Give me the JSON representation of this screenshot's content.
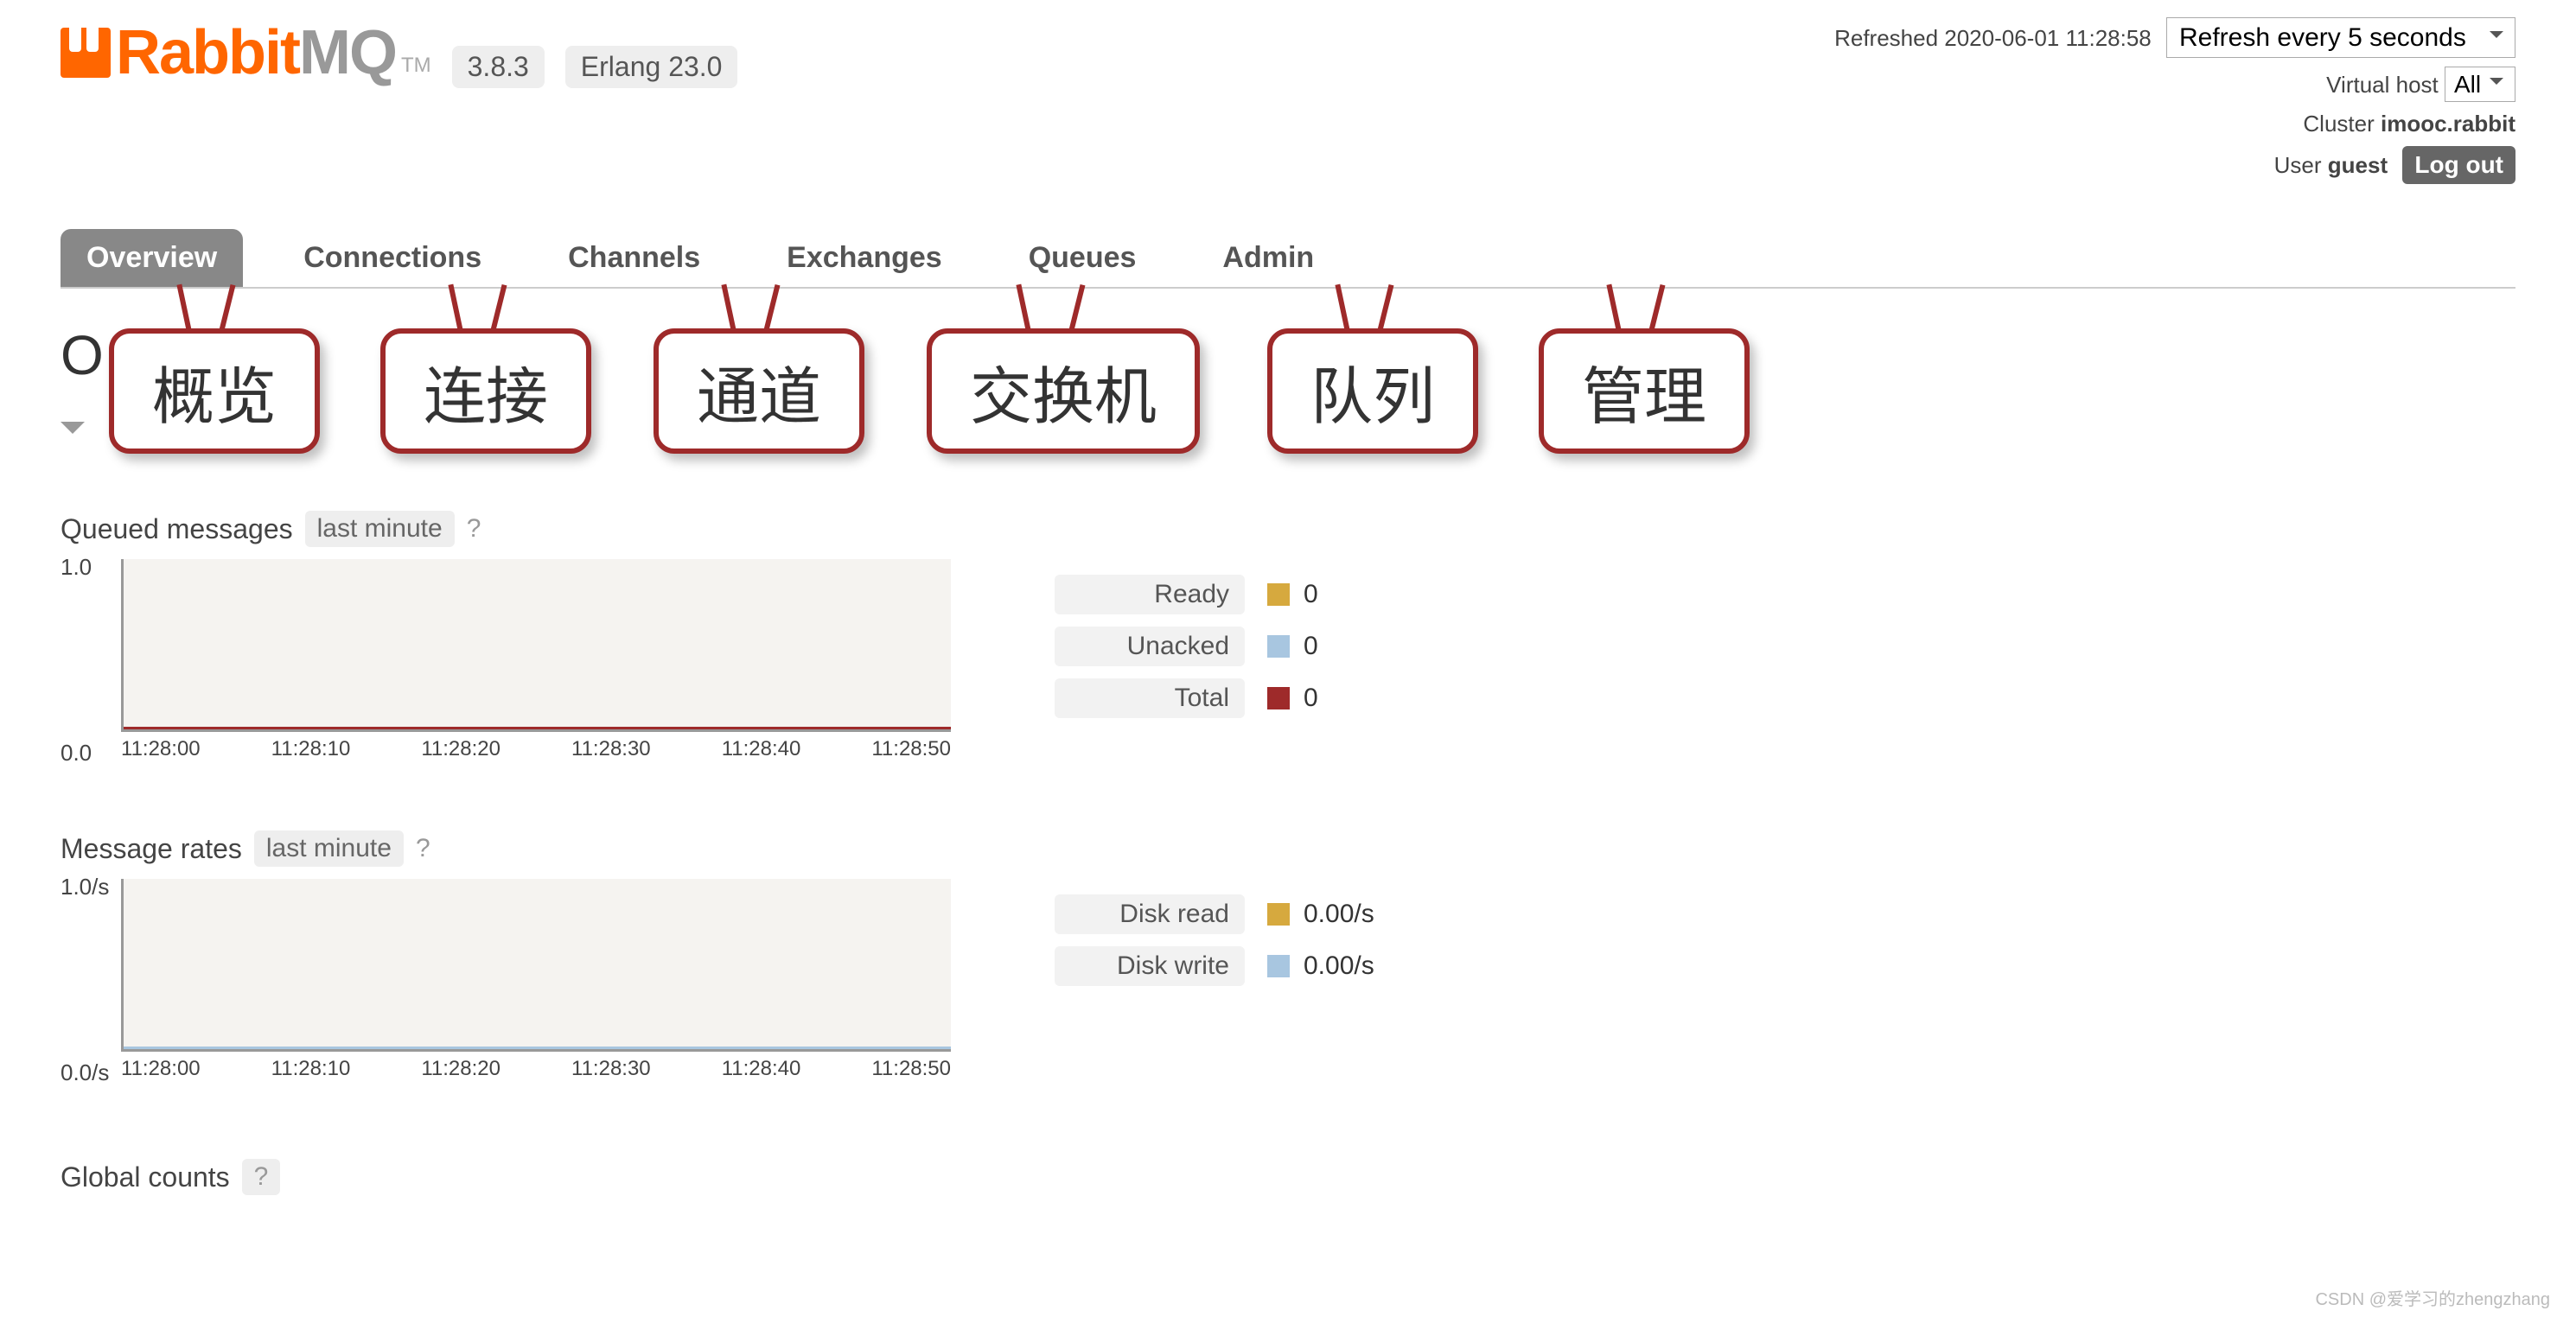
{
  "header": {
    "brand_rabbit": "Rabbit",
    "brand_mq": "MQ",
    "tm": "TM",
    "version": "3.8.3",
    "erlang": "Erlang 23.0",
    "refreshed": "Refreshed 2020-06-01 11:28:58",
    "refresh_select": "Refresh every 5 seconds",
    "vhost_label": "Virtual host",
    "vhost_value": "All",
    "cluster_label": "Cluster",
    "cluster_value": "imooc.rabbit",
    "user_label": "User",
    "user_value": "guest",
    "logout": "Log out"
  },
  "tabs": [
    {
      "label": "Overview",
      "active": true
    },
    {
      "label": "Connections",
      "active": false
    },
    {
      "label": "Channels",
      "active": false
    },
    {
      "label": "Exchanges",
      "active": false
    },
    {
      "label": "Queues",
      "active": false
    },
    {
      "label": "Admin",
      "active": false
    }
  ],
  "page_initial": "O",
  "callouts": [
    "概览",
    "连接",
    "通道",
    "交换机",
    "队列",
    "管理"
  ],
  "queued": {
    "title": "Queued messages",
    "range": "last minute",
    "help": "?",
    "y_top": "1.0",
    "y_bot": "0.0",
    "x": [
      "11:28:00",
      "11:28:10",
      "11:28:20",
      "11:28:30",
      "11:28:40",
      "11:28:50"
    ],
    "legend": [
      {
        "label": "Ready",
        "value": "0",
        "color": "#d6a93e"
      },
      {
        "label": "Unacked",
        "value": "0",
        "color": "#a8c6e0"
      },
      {
        "label": "Total",
        "value": "0",
        "color": "#9e2a2a"
      }
    ]
  },
  "rates": {
    "title": "Message rates",
    "range": "last minute",
    "help": "?",
    "y_top": "1.0/s",
    "y_bot": "0.0/s",
    "x": [
      "11:28:00",
      "11:28:10",
      "11:28:20",
      "11:28:30",
      "11:28:40",
      "11:28:50"
    ],
    "legend": [
      {
        "label": "Disk read",
        "value": "0.00/s",
        "color": "#d6a93e"
      },
      {
        "label": "Disk write",
        "value": "0.00/s",
        "color": "#a8c6e0"
      }
    ]
  },
  "global": {
    "title": "Global counts",
    "help": "?"
  },
  "watermark": "CSDN @爱学习的zhengzhang",
  "chart_data": [
    {
      "type": "line",
      "title": "Queued messages",
      "x": [
        "11:28:00",
        "11:28:10",
        "11:28:20",
        "11:28:30",
        "11:28:40",
        "11:28:50"
      ],
      "series": [
        {
          "name": "Ready",
          "values": [
            0,
            0,
            0,
            0,
            0,
            0
          ]
        },
        {
          "name": "Unacked",
          "values": [
            0,
            0,
            0,
            0,
            0,
            0
          ]
        },
        {
          "name": "Total",
          "values": [
            0,
            0,
            0,
            0,
            0,
            0
          ]
        }
      ],
      "ylim": [
        0,
        1.0
      ]
    },
    {
      "type": "line",
      "title": "Message rates",
      "x": [
        "11:28:00",
        "11:28:10",
        "11:28:20",
        "11:28:30",
        "11:28:40",
        "11:28:50"
      ],
      "series": [
        {
          "name": "Disk read",
          "values": [
            0,
            0,
            0,
            0,
            0,
            0
          ]
        },
        {
          "name": "Disk write",
          "values": [
            0,
            0,
            0,
            0,
            0,
            0
          ]
        }
      ],
      "ylim": [
        0,
        1.0
      ]
    }
  ]
}
